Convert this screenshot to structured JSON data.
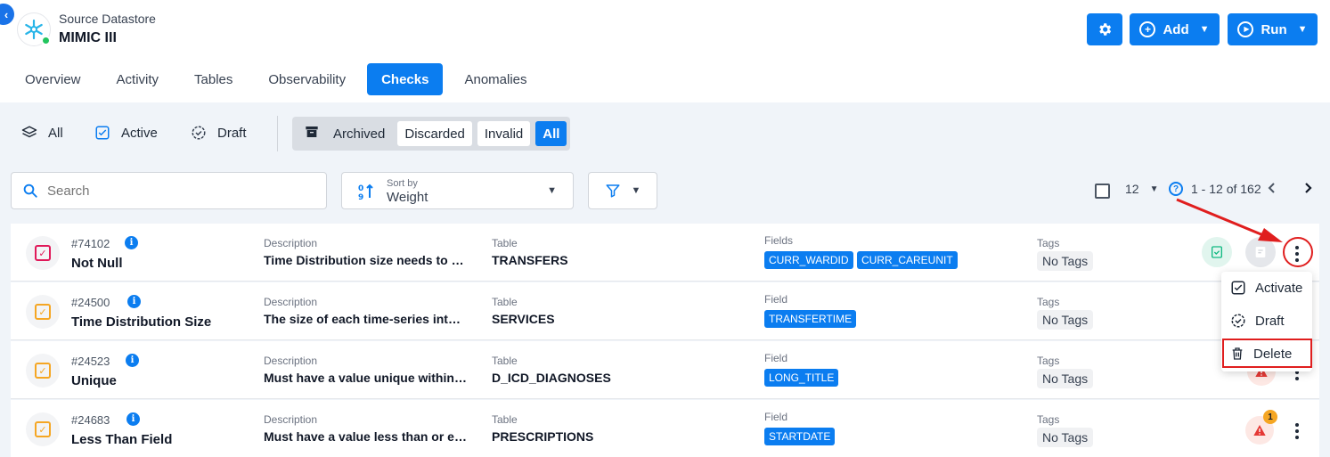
{
  "header": {
    "subtitle": "Source Datastore",
    "title": "MIMIC III",
    "buttons": {
      "add": "Add",
      "run": "Run"
    }
  },
  "tabs": [
    "Overview",
    "Activity",
    "Tables",
    "Observability",
    "Checks",
    "Anomalies"
  ],
  "active_tab": "Checks",
  "status_filter": {
    "all": "All",
    "active": "Active",
    "draft": "Draft"
  },
  "archive_filter": {
    "archived": "Archived",
    "discarded": "Discarded",
    "invalid": "Invalid",
    "all": "All"
  },
  "search": {
    "placeholder": "Search"
  },
  "sort": {
    "label": "Sort by",
    "value": "Weight"
  },
  "pagination": {
    "page_size": "12",
    "range": "1 - 12 of 162"
  },
  "rows": [
    {
      "id": "#74102",
      "name": "Not Null",
      "desc_label": "Description",
      "desc": "Time Distribution size needs to be...",
      "table_label": "Table",
      "table": "TRANSFERS",
      "fields_label": "Fields",
      "fields": [
        "CURR_WARDID",
        "CURR_CAREUNIT"
      ],
      "tags_label": "Tags",
      "tags": "No Tags",
      "icon_color": "#e0195a"
    },
    {
      "id": "#24500",
      "name": "Time Distribution Size",
      "desc_label": "Description",
      "desc": "The size of each time-series inter...",
      "table_label": "Table",
      "table": "SERVICES",
      "fields_label": "Field",
      "fields": [
        "TRANSFERTIME"
      ],
      "tags_label": "Tags",
      "tags": "No Tags",
      "icon_color": "#f5a623"
    },
    {
      "id": "#24523",
      "name": "Unique",
      "desc_label": "Description",
      "desc": "Must have a value unique within t...",
      "table_label": "Table",
      "table": "D_ICD_DIAGNOSES",
      "fields_label": "Field",
      "fields": [
        "LONG_TITLE"
      ],
      "tags_label": "Tags",
      "tags": "No Tags",
      "icon_color": "#f5a623"
    },
    {
      "id": "#24683",
      "name": "Less Than Field",
      "desc_label": "Description",
      "desc": "Must have a value less than or eq...",
      "table_label": "Table",
      "table": "PRESCRIPTIONS",
      "fields_label": "Field",
      "fields": [
        "STARTDATE"
      ],
      "tags_label": "Tags",
      "tags": "No Tags",
      "icon_color": "#f5a623",
      "anomaly_count": "1"
    }
  ],
  "menu": {
    "activate": "Activate",
    "draft": "Draft",
    "delete": "Delete"
  },
  "colors": {
    "primary": "#0b7df0",
    "annotation": "#e01e1e",
    "warning": "#e53935"
  }
}
